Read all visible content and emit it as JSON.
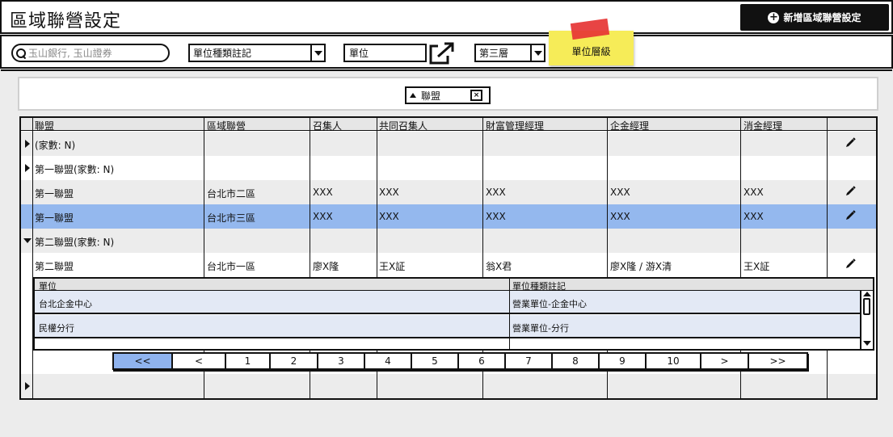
{
  "header": {
    "title": "區域聯營設定",
    "add_button_label": "新增區域聯營設定"
  },
  "filters": {
    "search_placeholder": "玉山銀行, 玉山證券",
    "unit_type_select": "單位種類註記",
    "unit_input": "單位",
    "layer_select": "第三層",
    "sticky_note": "單位層級"
  },
  "grouping": {
    "chip_label": "聯盟",
    "close_symbol": "×"
  },
  "grid": {
    "columns": [
      "聯盟",
      "區域聯營",
      "召集人",
      "共同召集人",
      "財富管理經理",
      "企金經理",
      "消金經理"
    ],
    "rows": [
      {
        "label": "(家數: N)"
      },
      {
        "label": "第一聯盟(家數: N)"
      },
      {
        "cells": [
          "第一聯盟",
          "台北市二區",
          "XXX",
          "XXX",
          "XXX",
          "XXX",
          "XXX"
        ]
      },
      {
        "cells": [
          "第一聯盟",
          "台北市三區",
          "XXX",
          "XXX",
          "XXX",
          "XXX",
          "XXX"
        ]
      },
      {
        "label": "第二聯盟(家數: N)"
      },
      {
        "cells": [
          "第二聯盟",
          "台北市一區",
          "廖X隆",
          "王X証",
          "翁X君",
          "廖X隆 / 游X清",
          "王X証"
        ]
      }
    ],
    "selected_row_index": 3
  },
  "nested": {
    "columns": [
      "單位",
      "單位種類註記"
    ],
    "rows": [
      [
        "台北企金中心",
        "營業單位-企金中心"
      ],
      [
        "民權分行",
        "營業單位-分行"
      ]
    ]
  },
  "pagination": {
    "pages": [
      "<<",
      "<",
      "1",
      "2",
      "3",
      "4",
      "5",
      "6",
      "7",
      "8",
      "9",
      "10",
      ">",
      ">>"
    ],
    "active_index": 0
  }
}
